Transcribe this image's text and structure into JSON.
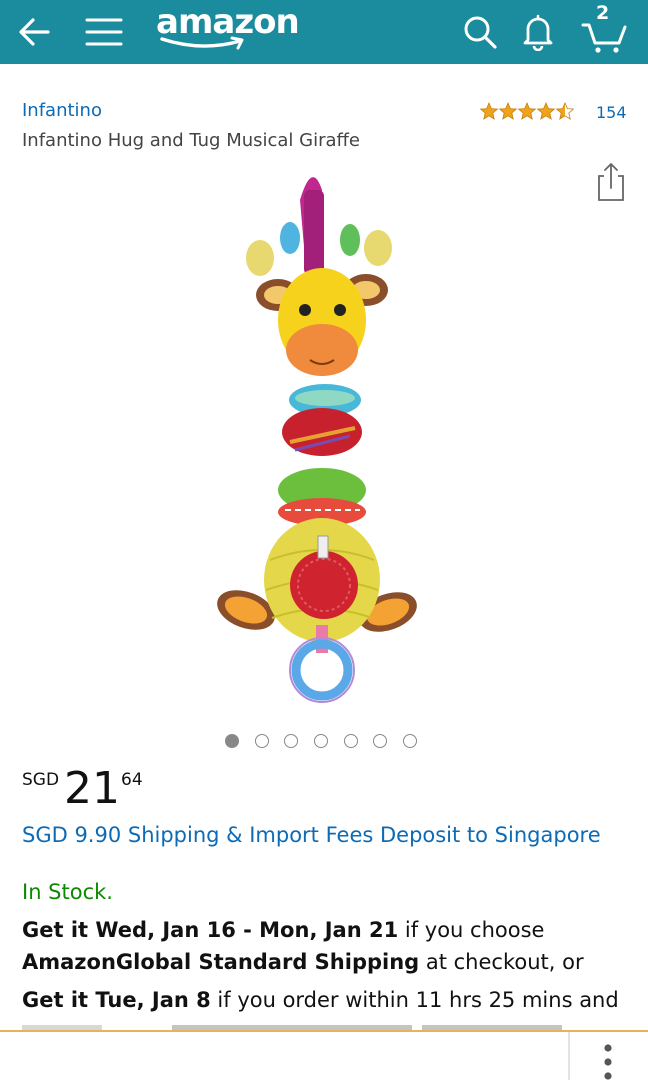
{
  "header": {
    "logo_text": "amazon",
    "cart_count": "2",
    "icons": [
      "back-arrow-icon",
      "menu-icon",
      "search-icon",
      "bell-icon",
      "cart-icon"
    ],
    "bg_color": "#1b8c9d"
  },
  "product": {
    "brand": "Infantino",
    "title": "Infantino Hug and Tug Musical Giraffe",
    "rating": 4.5,
    "review_count": "154"
  },
  "gallery": {
    "image_count": 7,
    "active_index": 0
  },
  "price": {
    "currency": "SGD",
    "whole": "21",
    "fraction": "64"
  },
  "shipping_link": "SGD 9.90 Shipping & Import Fees Deposit to Singapore",
  "availability": "In Stock.",
  "delivery": {
    "line1_bold": "Get it Wed, Jan 16 - Mon, Jan 21",
    "line1_rest": " if you choose",
    "line2_bold": "AmazonGlobal Standard Shipping",
    "line2_rest": " at checkout, or",
    "line3_bold": "Get it Tue, Jan 8",
    "line3_rest": " if you order within 11 hrs 25 mins and"
  },
  "colors": {
    "link": "#0d6bb5",
    "in_stock": "#0b8a00",
    "star": "#f0a21a",
    "divider": "#e8b25a"
  }
}
